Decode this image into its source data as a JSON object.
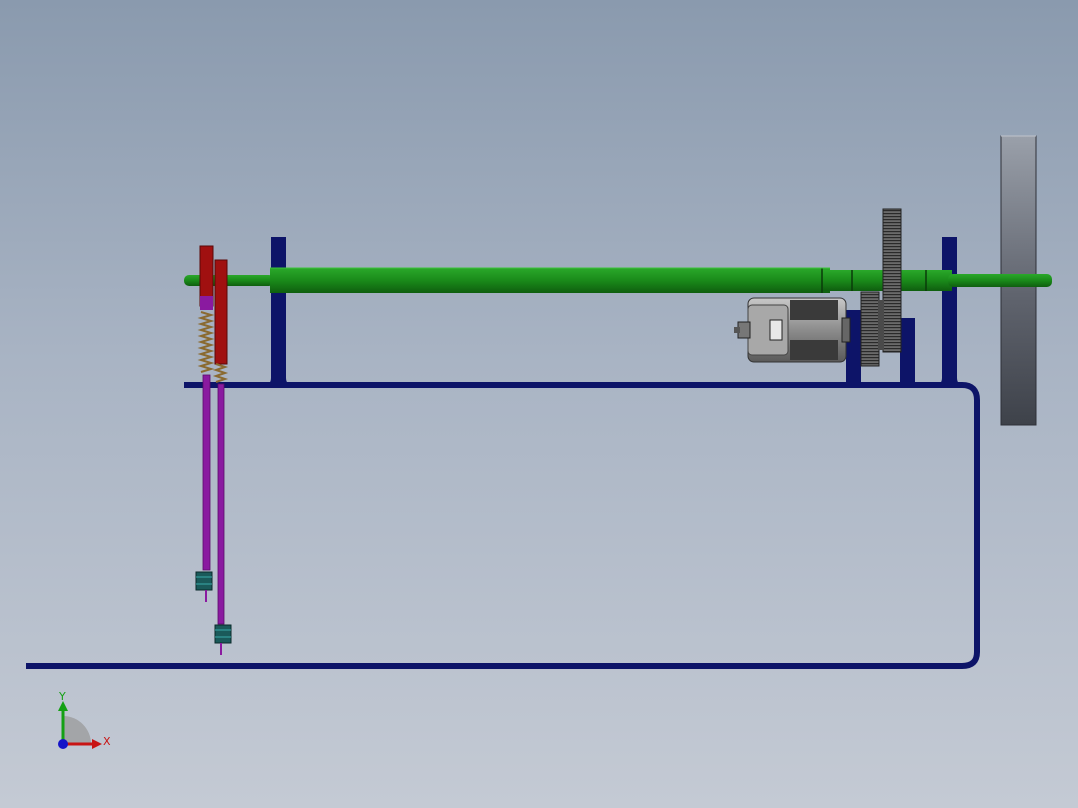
{
  "colors": {
    "frame": "#0d1468",
    "shaft": "#1a8a1a",
    "shaft_dark": "#0f5e0f",
    "clamp": "#a01010",
    "rod": "#8a1aa0",
    "spring": "#7a5a30",
    "tip": "#1a5a5a",
    "motor": "#8a8a8a",
    "gear": "#555555",
    "wheel": "#5a5e66"
  },
  "triad": {
    "x_label": "X",
    "y_label": "Y",
    "x_color": "#c81414",
    "y_color": "#14a014",
    "z_color": "#1414c8"
  },
  "parts": {
    "frame": "frame-tube",
    "shaft": "drive-shaft",
    "motor": "dc-motor",
    "gears": "spur-gears",
    "wheel": "drive-wheel",
    "arms": "pen-arms"
  }
}
